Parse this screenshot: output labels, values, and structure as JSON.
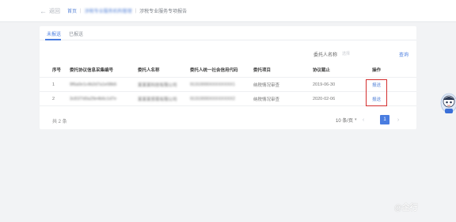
{
  "header": {
    "back_label": "返回",
    "breadcrumb": [
      {
        "label": "首页",
        "type": "link"
      },
      {
        "label": "涉税专业服务机构管理",
        "type": "link-blurred"
      },
      {
        "label": "涉税专业服务专项报告",
        "type": "current"
      }
    ]
  },
  "tabs": [
    {
      "label": "未报送",
      "active": true
    },
    {
      "label": "已报送",
      "active": false
    }
  ],
  "filter": {
    "label": "委托人名称",
    "placeholder": "选择",
    "button_label": "查询"
  },
  "table": {
    "columns": [
      "序号",
      "委托协议信息采集编号",
      "委托人名称",
      "委托人统一社会信用代码",
      "委托项目",
      "协议截止",
      "操作"
    ],
    "rows": [
      {
        "no": "1",
        "code": "9f6a0e1c4b2d7a1e08b5",
        "name": "某某某科技有限公司",
        "credit": "91310000XXXXXXXX1",
        "project": "纳税情况审查",
        "deadline": "2019-06-30",
        "action": "报送"
      },
      {
        "no": "2",
        "code": "3c81f7d0a29e4b6c1d7e",
        "name": "某某某贸易有限公司",
        "credit": "91310000XXXXXXXX2",
        "project": "纳税情况审查",
        "deadline": "2020-02-06",
        "action": "报送"
      }
    ]
  },
  "pagination": {
    "total_label": "共 2 条",
    "page_size_label": "10 条/页",
    "current_page": "1"
  },
  "watermark": {
    "text": "@企行"
  },
  "colors": {
    "accent": "#4a7de0",
    "highlight_box": "#d42f2f"
  }
}
